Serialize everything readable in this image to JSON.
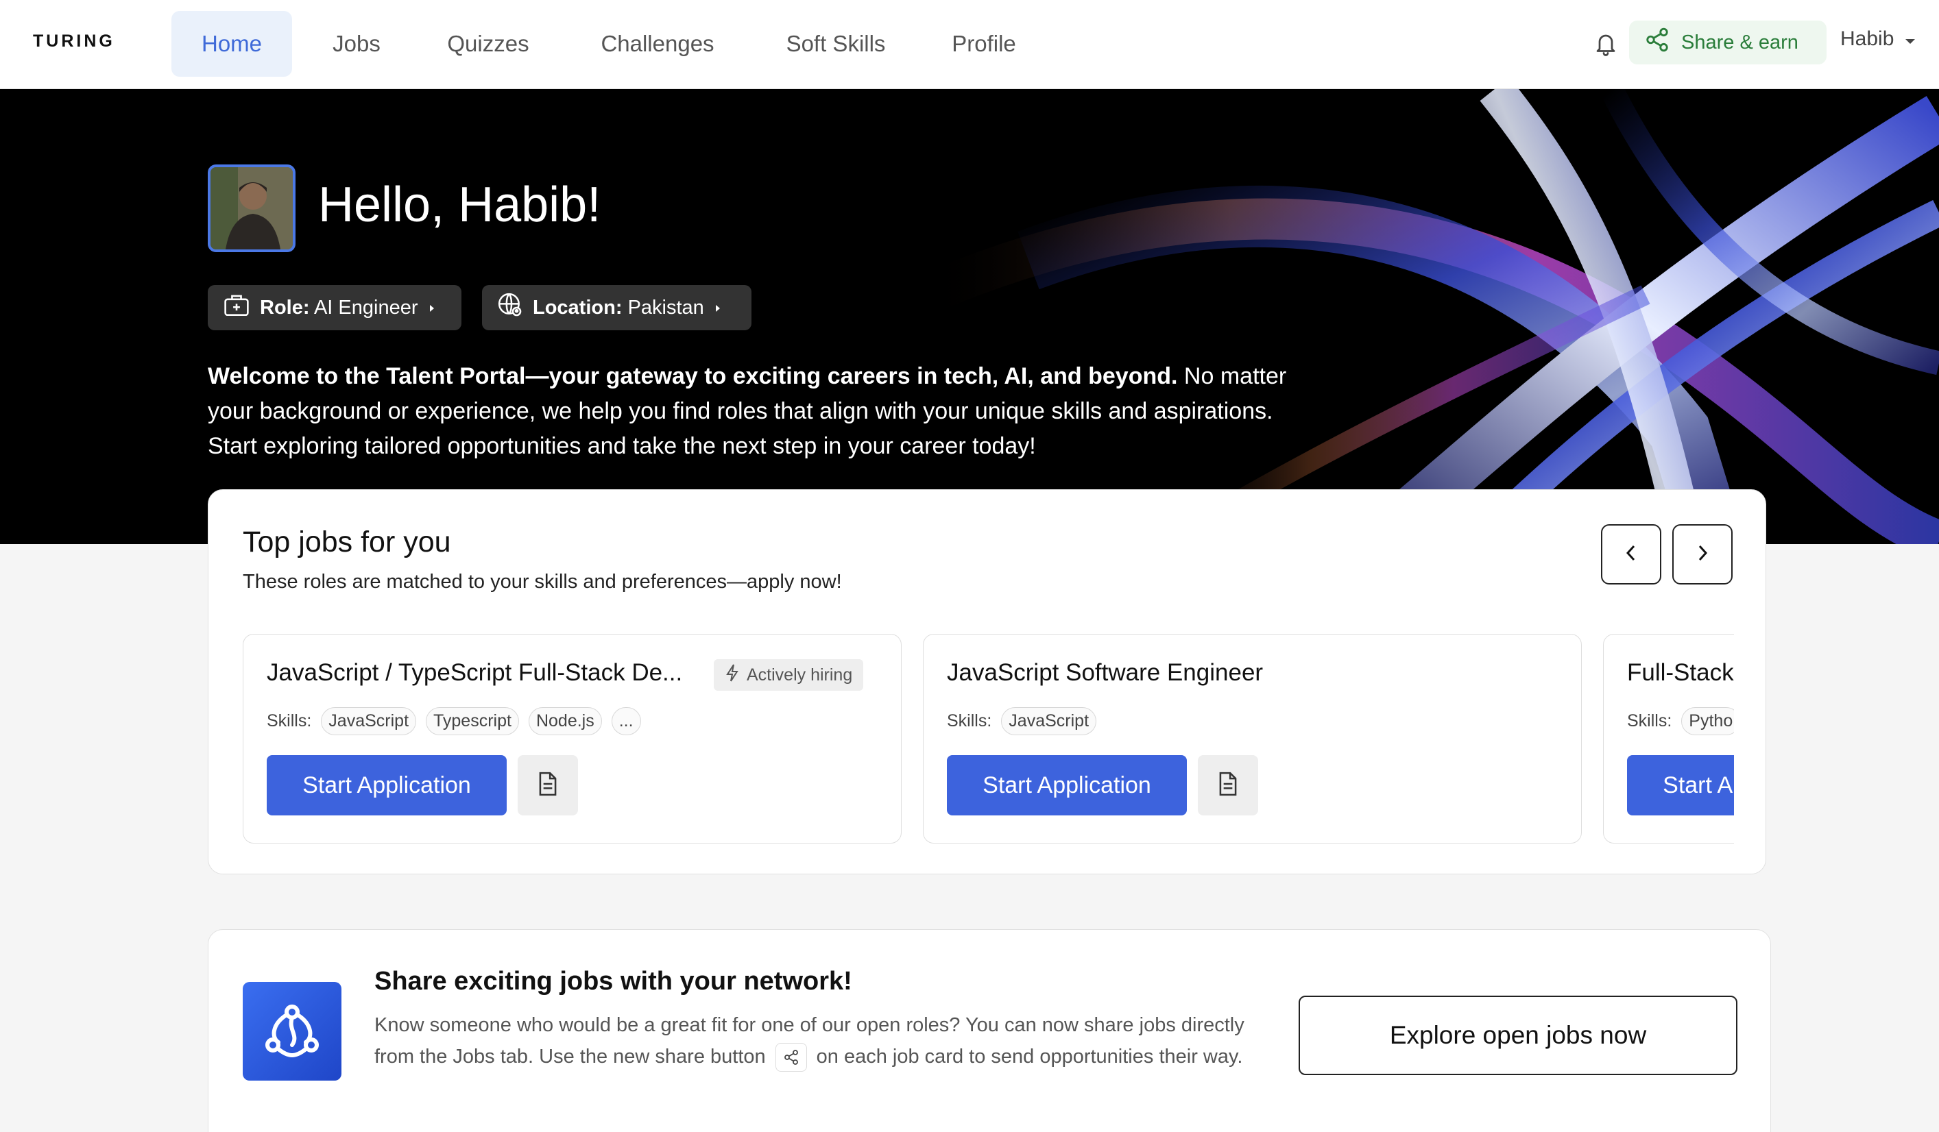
{
  "nav": {
    "logo": "TURING",
    "items": [
      {
        "label": "Home",
        "active": true
      },
      {
        "label": "Jobs"
      },
      {
        "label": "Quizzes"
      },
      {
        "label": "Challenges"
      },
      {
        "label": "Soft Skills"
      },
      {
        "label": "Profile"
      }
    ],
    "share_earn": "Share & earn",
    "user_name": "Habib"
  },
  "hero": {
    "greeting": "Hello, Habib!",
    "role_label": "Role:",
    "role_value": "AI Engineer",
    "location_label": "Location:",
    "location_value": "Pakistan",
    "intro_bold": "Welcome to the Talent Portal—your gateway to exciting careers in tech, AI, and beyond.",
    "intro_rest": " No matter your background or experience, we help you find roles that align with your unique skills and aspirations. Start exploring tailored opportunities and take the next step in your career today!"
  },
  "top_jobs": {
    "title": "Top jobs for you",
    "subtitle": "These roles are matched to your skills and preferences—apply now!",
    "skills_label": "Skills:",
    "start_label": "Start Application",
    "jobs": [
      {
        "title": "JavaScript / TypeScript Full-Stack De...",
        "badge": "Actively hiring",
        "skills": [
          "JavaScript",
          "Typescript",
          "Node.js",
          "..."
        ]
      },
      {
        "title": "JavaScript Software Engineer",
        "skills": [
          "JavaScript"
        ]
      },
      {
        "title": "Full-Stack",
        "skills": [
          "Pytho"
        ]
      }
    ]
  },
  "share": {
    "title": "Share exciting jobs with your network!",
    "text_before": "Know someone who would be a great fit for one of our open roles? You can now share jobs directly from the Jobs tab. Use the new share button",
    "text_after": "on each job card to send opportunities their way.",
    "button": "Explore open jobs now"
  },
  "colors": {
    "accent": "#3d63dd",
    "nav_active_bg": "#eaf1fb",
    "share_green": "#2a7d3a",
    "hero_bg": "#000000"
  }
}
